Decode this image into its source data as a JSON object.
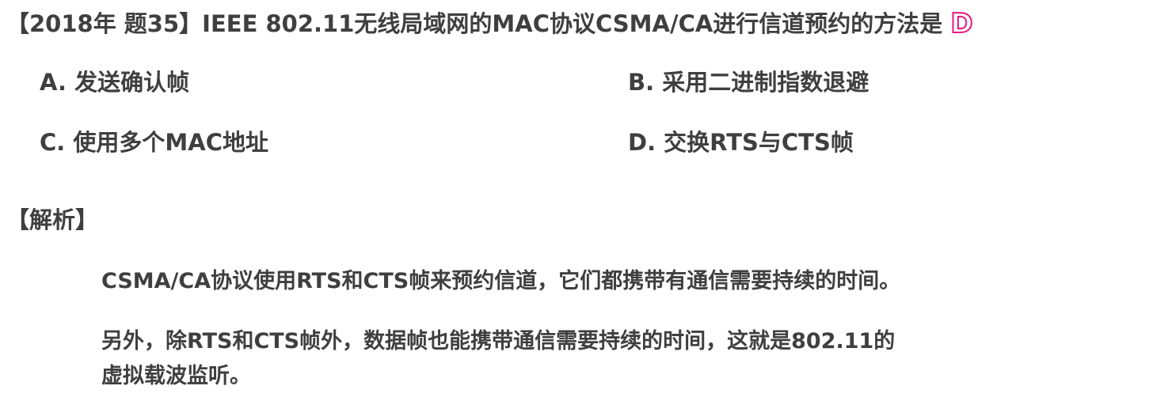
{
  "question": {
    "text": "【2018年 题35】IEEE 802.11无线局域网的MAC协议CSMA/CA进行信道预约的方法是",
    "answer": "D",
    "answer_color": "#e5177f"
  },
  "options": {
    "a": "A. 发送确认帧",
    "b": "B. 采用二进制指数退避",
    "c": "C. 使用多个MAC地址",
    "d": "D. 交换RTS与CTS帧"
  },
  "analysis": {
    "title": "【解析】",
    "para1": "CSMA/CA协议使用RTS和CTS帧来预约信道，它们都携带有通信需要持续的时间。",
    "para2_line1": "另外，除RTS和CTS帧外，数据帧也能携带通信需要持续的时间，这就是802.11的",
    "para2_line2": "虚拟载波监听。"
  }
}
